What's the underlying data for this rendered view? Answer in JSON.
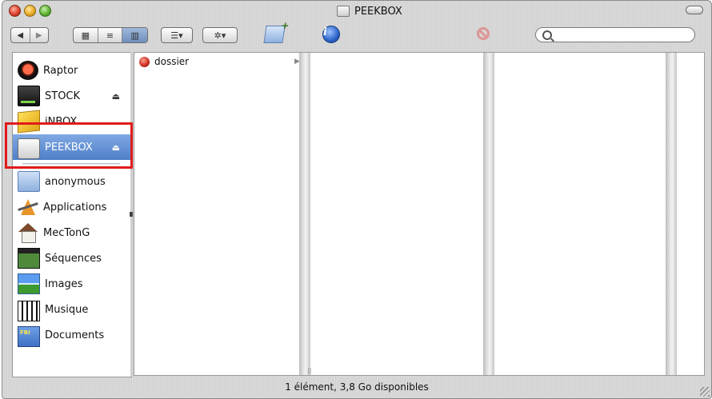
{
  "window": {
    "title": "PEEKBOX"
  },
  "toolbar": {
    "back_icon": "back-arrow-icon",
    "forward_icon": "forward-arrow-icon",
    "view_icon_mode": "icon-view-icon",
    "view_list_mode": "list-view-icon",
    "view_column_mode": "column-view-icon",
    "search": {
      "placeholder": ""
    }
  },
  "sidebar": {
    "devices": [
      {
        "label": "Raptor",
        "icon": "globe-disk-icon",
        "eject": ""
      },
      {
        "label": "STOCK",
        "icon": "hard-drive-icon",
        "eject": "⏏"
      },
      {
        "label": "iNBOX",
        "icon": "inbox-disk-icon",
        "eject": ""
      },
      {
        "label": "PEEKBOX",
        "icon": "external-disk-icon",
        "eject": "⏏",
        "selected": true
      }
    ],
    "places": [
      {
        "label": "anonymous",
        "icon": "folder-icon"
      },
      {
        "label": "Applications",
        "icon": "applications-icon"
      },
      {
        "label": "MecTonG",
        "icon": "home-icon"
      },
      {
        "label": "Séquences",
        "icon": "movies-icon"
      },
      {
        "label": "Images",
        "icon": "pictures-icon"
      },
      {
        "label": "Musique",
        "icon": "music-icon"
      },
      {
        "label": "Documents",
        "icon": "documents-icon"
      }
    ]
  },
  "columns": [
    {
      "items": [
        {
          "name": "dossier",
          "icon": "folder-icon",
          "has_children": true
        }
      ]
    },
    {
      "items": []
    },
    {
      "items": []
    }
  ],
  "status": {
    "text": "1 élément, 3,8 Go disponibles"
  },
  "colors": {
    "selection": "#4f7fc8",
    "highlight_box": "#e01b1b"
  }
}
